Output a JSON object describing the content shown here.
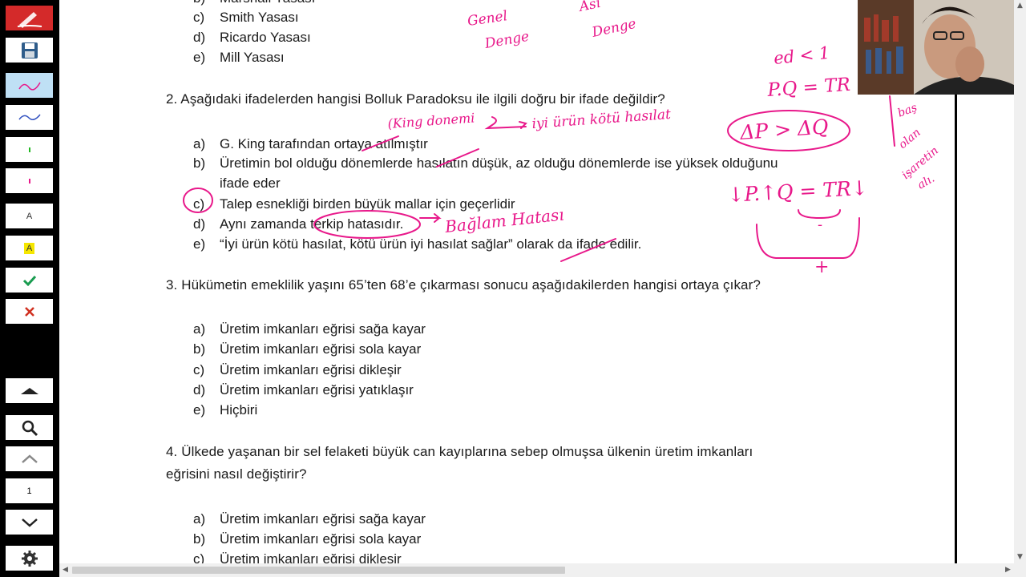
{
  "toolbar": {
    "buttons": [
      {
        "icon": "pen-logo-icon"
      },
      {
        "icon": "save-icon"
      },
      {
        "icon": "pink-pen-icon"
      },
      {
        "icon": "blue-pen-icon"
      },
      {
        "icon": "green-dot-icon"
      },
      {
        "icon": "pink-dot-icon"
      },
      {
        "icon": "text-tool-icon"
      },
      {
        "icon": "highlighter-icon"
      },
      {
        "icon": "check-icon"
      },
      {
        "icon": "close-icon"
      },
      {
        "icon": "up-triangle-icon"
      },
      {
        "icon": "search-icon"
      },
      {
        "icon": "chevron-up-icon"
      },
      {
        "icon": "chevron-down-icon"
      },
      {
        "icon": "gear-icon"
      }
    ],
    "page_number": "1",
    "text_tool_label_1": "A",
    "text_tool_label_2": "A"
  },
  "document": {
    "q1_tail": [
      {
        "letter": "b)",
        "text": "Marshall Yasası"
      },
      {
        "letter": "c)",
        "text": "Smith Yasası"
      },
      {
        "letter": "d)",
        "text": "Ricardo Yasası"
      },
      {
        "letter": "e)",
        "text": "Mill Yasası"
      }
    ],
    "q2": {
      "question": "2. Aşağıdaki ifadelerden hangisi Bolluk Paradoksu ile ilgili doğru bir ifade değildir?",
      "options": [
        {
          "letter": "a)",
          "text": "G. King tarafından ortaya atılmıştır"
        },
        {
          "letter": "b)",
          "text": "Üretimin bol olduğu dönemlerde hasılatın düşük, az olduğu dönemlerde ise yüksek olduğunu"
        },
        {
          "letter": "",
          "text": "ifade eder"
        },
        {
          "letter": "c)",
          "text": "Talep esnekliği birden büyük mallar için geçerlidir"
        },
        {
          "letter": "d)",
          "text": "Aynı zamanda terkip hatasıdır."
        },
        {
          "letter": "e)",
          "text": "“İyi ürün kötü hasılat, kötü ürün iyi hasılat sağlar” olarak da ifade edilir."
        }
      ]
    },
    "q3": {
      "question": "3. Hükümetin emeklilik yaşını 65’ten 68’e çıkarması sonucu aşağıdakilerden hangisi ortaya çıkar?",
      "options": [
        {
          "letter": "a)",
          "text": "Üretim imkanları eğrisi sağa kayar"
        },
        {
          "letter": "b)",
          "text": "Üretim imkanları eğrisi sola kayar"
        },
        {
          "letter": "c)",
          "text": "Üretim imkanları eğrisi dikleşir"
        },
        {
          "letter": "d)",
          "text": "Üretim imkanları eğrisi yatıklaşır"
        },
        {
          "letter": "e)",
          "text": "Hiçbiri"
        }
      ]
    },
    "q4": {
      "question_line1": "4. Ülkede yaşanan bir sel felaketi büyük can kayıplarına sebep olmuşsa ülkenin üretim imkanları",
      "question_line2": "eğrisini nasıl değiştirir?",
      "options": [
        {
          "letter": "a)",
          "text": "Üretim imkanları eğrisi sağa kayar"
        },
        {
          "letter": "b)",
          "text": "Üretim imkanları eğrisi sola kayar"
        },
        {
          "letter": "c)",
          "text": "Üretim imkanları eğrisi dikleşir"
        }
      ]
    }
  },
  "annotations": {
    "genel_denge": [
      "Genel",
      "Denge"
    ],
    "kismi_denge": [
      "Ası",
      "Denge"
    ],
    "king_note": "(King donemi",
    "iyi_urun_note": "iyi ürün kötü hasılat",
    "baglam_hatasi": "Bağlam Hatası",
    "elasticity": "ed < 1",
    "revenue_eq": "P.Q = TR",
    "delta": "ΔP > ΔQ",
    "tr_down": "↓P.↑Q = TR↓",
    "minus": "-",
    "plus": "+",
    "side_note": [
      "baş",
      "olan",
      "işaretin",
      "alı."
    ]
  },
  "colors": {
    "ink": "#e8188a",
    "toolbar_bg": "#000000",
    "active_tool": "#bfe0f5",
    "red_logo": "#d42a2a"
  }
}
